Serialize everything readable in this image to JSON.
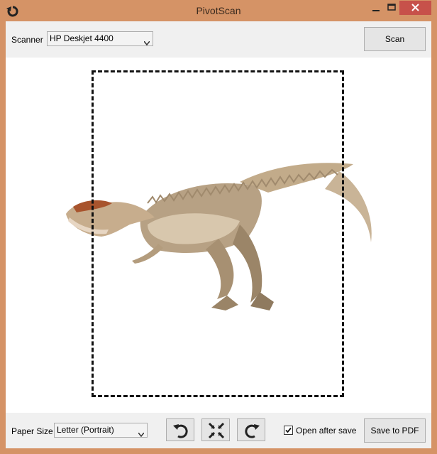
{
  "window": {
    "title": "PivotScan"
  },
  "toolbar": {
    "scanner_label": "Scanner",
    "scanner_value": "HP Deskjet 4400",
    "scan_button": "Scan"
  },
  "bottom": {
    "paper_size_label": "Paper Size",
    "paper_size_value": "Letter (Portrait)",
    "rotate_left_icon": "rotate-left-icon",
    "fit_icon": "shrink-icon",
    "rotate_right_icon": "rotate-right-icon",
    "open_after_save_label": "Open after save",
    "open_after_save_checked": true,
    "save_button": "Save to PDF"
  },
  "colors": {
    "frame": "#d59366",
    "close": "#c7514a"
  }
}
